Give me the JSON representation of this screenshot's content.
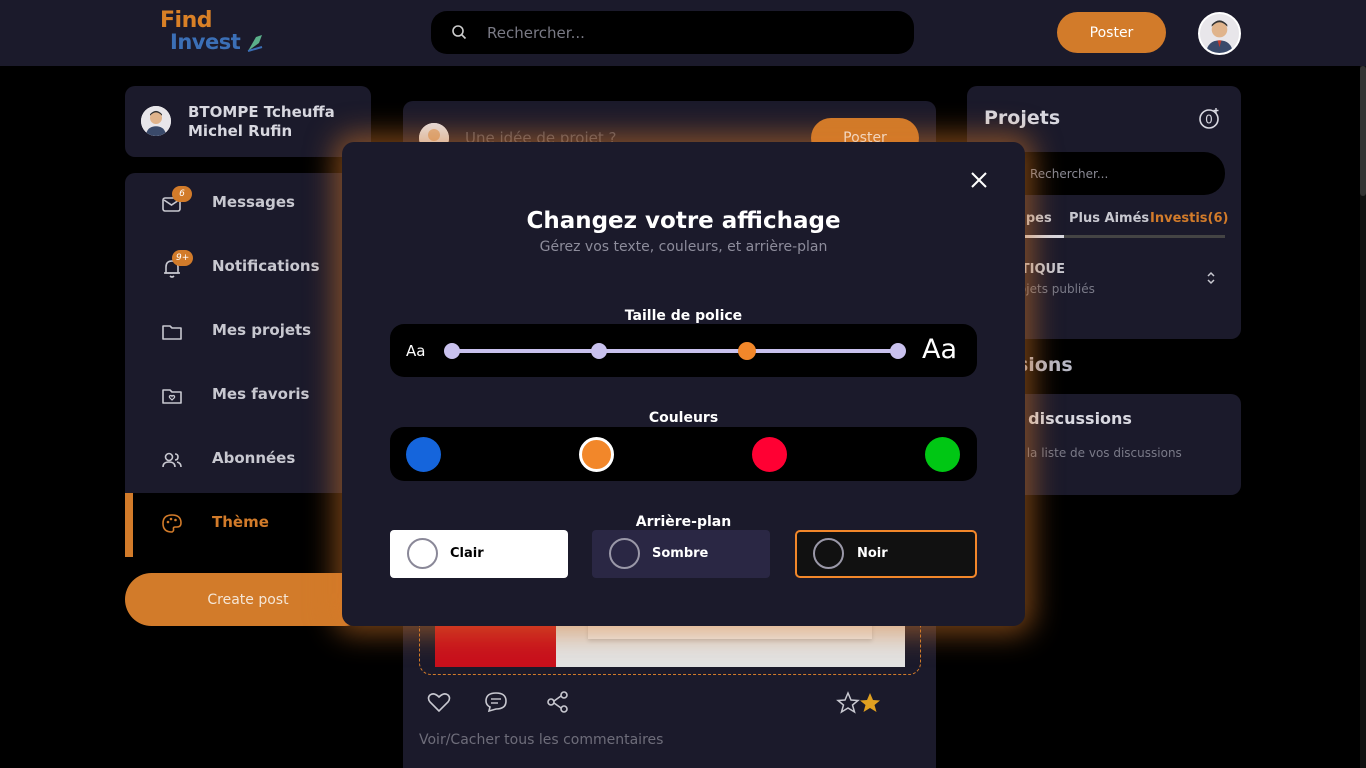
{
  "header": {
    "logo_find": "Find",
    "logo_invest": "Invest",
    "search_placeholder": "Rechercher...",
    "post_button": "Poster"
  },
  "profile": {
    "name": "BTOMPE Tcheuffa Michel Rufin"
  },
  "sidebar": {
    "items": [
      {
        "label": "Messages",
        "icon": "mail-icon",
        "badge": "6"
      },
      {
        "label": "Notifications",
        "icon": "bell-icon",
        "badge": "9+"
      },
      {
        "label": "Mes projets",
        "icon": "folder-icon",
        "badge": ""
      },
      {
        "label": "Mes favoris",
        "icon": "favorite-folder-icon",
        "badge": ""
      },
      {
        "label": "Abonnées",
        "icon": "users-icon",
        "badge": ""
      },
      {
        "label": "Thème",
        "icon": "palette-icon",
        "badge": "",
        "active": true
      }
    ],
    "create_post": "Create post"
  },
  "feed": {
    "composer_placeholder": "Une idée de projet ?",
    "composer_button": "Poster",
    "toggle_comments": "Voir/Cacher tous les commentaires"
  },
  "projects": {
    "title": "Projets",
    "search_placeholder": "Rechercher...",
    "tabs": [
      {
        "label": "...pes",
        "active": false
      },
      {
        "label": "Plus Aimés",
        "active": false
      },
      {
        "label": "Investis(6)",
        "active": true
      }
    ],
    "category": "...MATIQUE",
    "category_sub": "...e projets publiés"
  },
  "discussions": {
    "title": "...ssions",
    "card_title": "...es discussions",
    "card_desc": "...sous la liste de vos discussions"
  },
  "modal": {
    "title": "Changez votre affichage",
    "subtitle": "Gérez vos texte, couleurs, et arrière-plan",
    "font_section": "Taille de police",
    "font_small": "Aa",
    "font_large": "Aa",
    "font_steps": 4,
    "font_selected_step": 3,
    "colors_section": "Couleurs",
    "colors": [
      {
        "hex": "#1565dc",
        "selected": false
      },
      {
        "hex": "#f2872a",
        "selected": true
      },
      {
        "hex": "#ff0033",
        "selected": false
      },
      {
        "hex": "#00c714",
        "selected": false
      }
    ],
    "background_section": "Arrière-plan",
    "backgrounds": [
      {
        "label": "Clair",
        "selected": false
      },
      {
        "label": "Sombre",
        "selected": false
      },
      {
        "label": "Noir",
        "selected": true
      }
    ]
  },
  "theme": {
    "accent": "#d27b2a",
    "panel": "#1b1a2b"
  }
}
